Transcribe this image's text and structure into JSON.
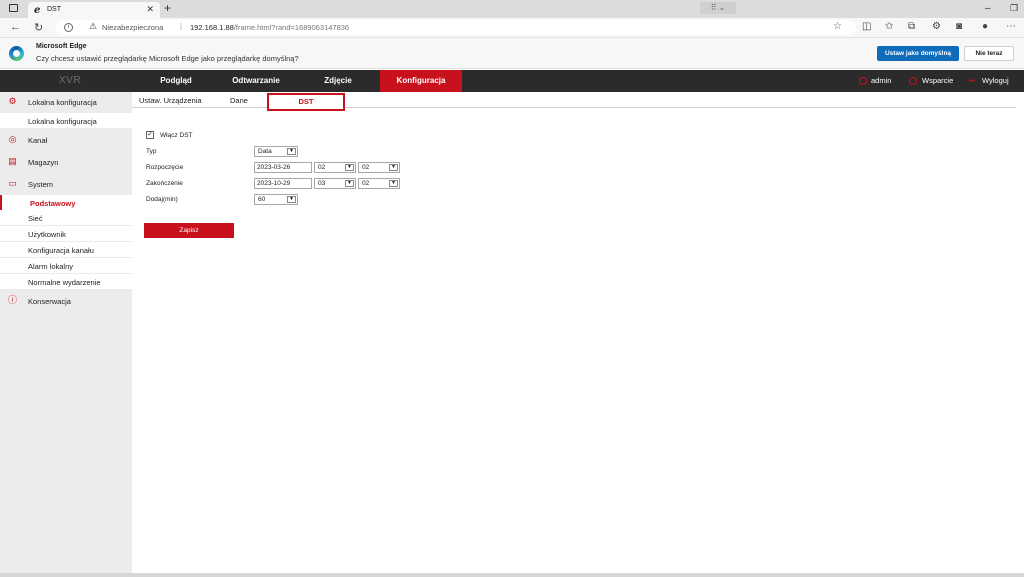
{
  "browser": {
    "tab_title": "DST",
    "address": {
      "security_label": "Niezabezpieczona",
      "host": "192.168.1.88",
      "path": "/frame.html?rand=1689063147836"
    }
  },
  "edge_prompt": {
    "heading": "Microsoft Edge",
    "message": "Czy chcesz ustawić przeglądarkę Microsoft Edge jako przeglądarkę domyślną?",
    "primary_label": "Ustaw jako domyślną",
    "secondary_label": "Nie teraz"
  },
  "app": {
    "brand": "XVR",
    "menu": [
      {
        "label": "Podgląd"
      },
      {
        "label": "Odtwarzanie"
      },
      {
        "label": "Zdjęcie"
      },
      {
        "label": "Konfiguracja"
      }
    ],
    "user": "admin",
    "support": "Wsparcie",
    "logout": "Wyloguj"
  },
  "sidebar": {
    "local_config": "Lokalna konfiguracja",
    "local_config_sub": "Lokalna konfiguracja",
    "channel": "Kanał",
    "storage": "Magazyn",
    "system": "System",
    "system_items": [
      "Podstawowy",
      "Sieć",
      "Użytkownik",
      "Konfiguracja kanału",
      "Alarm lokalny",
      "Normalne wydarzenie"
    ],
    "maintenance": "Konserwacja"
  },
  "subtabs": [
    "Ustaw. Urządzenia",
    "Dane",
    "DST"
  ],
  "form": {
    "enable_dst_label": "Włącz DST",
    "enable_dst_checked": true,
    "type_label": "Typ",
    "type_value": "Data",
    "start_label": "Rozpoczęcie",
    "start_date": "2023-03-26",
    "start_hour": "02",
    "start_minute": "02",
    "end_label": "Zakończenie",
    "end_date": "2023-10-29",
    "end_hour": "03",
    "end_minute": "02",
    "offset_label": "Dodaj(min)",
    "offset_value": "60",
    "save_label": "Zapisz"
  },
  "colors": {
    "accent": "#c9101d",
    "nav_bg": "#2b2b2b",
    "edge_blue": "#0f6cbd"
  }
}
